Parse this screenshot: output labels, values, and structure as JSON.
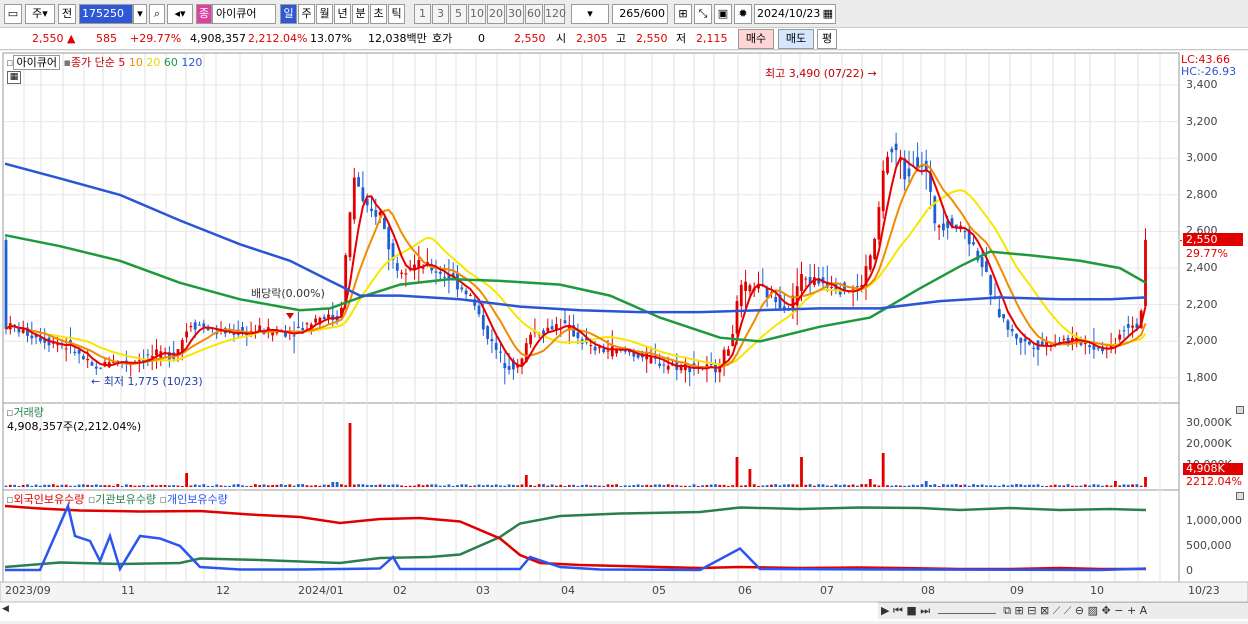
{
  "toolbar": {
    "period_select": "주",
    "prev_label": "전",
    "code": "175250",
    "stock_name": "아이큐어",
    "name_prefix": "종",
    "timeframes": [
      "일",
      "주",
      "월",
      "년",
      "분",
      "초",
      "틱"
    ],
    "intervals": [
      "1",
      "3",
      "5",
      "10",
      "20",
      "30",
      "60",
      "120"
    ],
    "count": "265",
    "count_total": "/600",
    "date": "2024/10/23"
  },
  "quote": {
    "price": "2,550",
    "change": "585",
    "change_pct": "+29.77%",
    "volume": "4,908,357",
    "volume_pct": "2,212.04%",
    "turnover_pct": "13.07%",
    "amount": "12,038백만",
    "hoga_label": "호가",
    "hoga_value": "0",
    "hoga_price": "2,550",
    "open_label": "시",
    "open": "2,305",
    "high_label": "고",
    "high": "2,550",
    "low_label": "저",
    "low": "2,115",
    "buy_label": "매수",
    "sell_label": "매도",
    "eval_label": "평"
  },
  "legend": {
    "name": "아이큐어",
    "price_type": "종가",
    "ma_type": "단순",
    "ma": [
      "5",
      "10",
      "20",
      "60",
      "120"
    ]
  },
  "corner": {
    "lc": "LC:43.66",
    "hc": "HC:-26.93"
  },
  "price_axis": [
    "3,400",
    "3,200",
    "3,000",
    "2,800",
    "2,600",
    "2,400",
    "2,200",
    "2,000",
    "1,800"
  ],
  "price_label": {
    "price": "2,550",
    "pct": "29.77%"
  },
  "annotations": {
    "high": "최고 3,490 (07/22)",
    "low": "최저 1,775 (10/23)",
    "dividend": "배당락(0.00%)"
  },
  "volume_panel": {
    "title": "거래량",
    "value": "4,908,357주(2,212.04%)",
    "axis": [
      "30,000K",
      "20,000K",
      "10,000K"
    ],
    "last": "4,908K",
    "last_pct": "2212.04%"
  },
  "holding_panel": {
    "items": [
      "외국인보유수량",
      "기관보유수량",
      "개인보유수량"
    ],
    "axis": [
      "1,000,000",
      "500,000",
      "0"
    ]
  },
  "dates": [
    "2023/09",
    "11",
    "12",
    "2024/01",
    "02",
    "03",
    "04",
    "05",
    "06",
    "07",
    "08",
    "09",
    "10",
    "10/23"
  ],
  "colors": {
    "up": "#e00000",
    "down": "#1f5fd4",
    "ma5": "#e60000",
    "ma10": "#f08c00",
    "ma20": "#f7e600",
    "ma60": "#1e9a3c",
    "ma120": "#2a55d6",
    "foreign": "#e00000",
    "inst": "#2a7f4f",
    "indiv": "#2a55f0"
  }
}
